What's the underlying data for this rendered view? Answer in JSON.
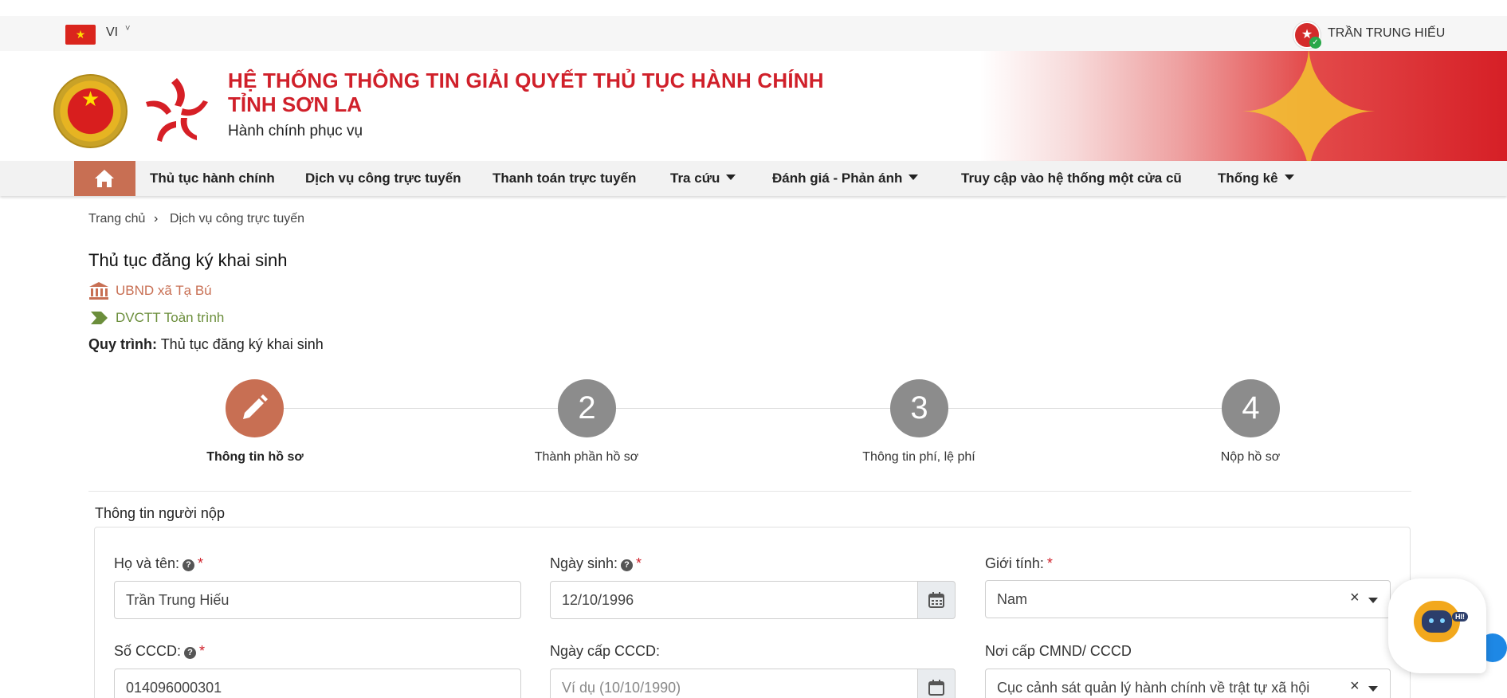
{
  "topbar": {
    "language": "VI",
    "user_name": "TRẦN TRUNG HIẾU"
  },
  "header": {
    "title_line1": "HỆ THỐNG THÔNG TIN GIẢI QUYẾT THỦ TỤC HÀNH CHÍNH",
    "title_line2": "TỈNH SƠN LA",
    "subtitle": "Hành chính phục vụ"
  },
  "nav": {
    "items": [
      {
        "label": "Thủ tục hành chính"
      },
      {
        "label": "Dịch vụ công trực tuyến"
      },
      {
        "label": "Thanh toán trực tuyến"
      },
      {
        "label": "Tra cứu"
      },
      {
        "label": "Đánh giá - Phản ánh"
      },
      {
        "label": "Truy cập vào hệ thống một cửa cũ"
      },
      {
        "label": "Thống kê"
      }
    ]
  },
  "breadcrumb": {
    "home": "Trang chủ",
    "current": "Dịch vụ công trực tuyến"
  },
  "procedure": {
    "title": "Thủ tục đăng ký khai sinh",
    "agency": "UBND xã Tạ Bú",
    "service_level": "DVCTT Toàn trình",
    "process_label": "Quy trình:",
    "process_value": "Thủ tục đăng ký khai sinh"
  },
  "steps": [
    {
      "number": "",
      "label": "Thông tin hồ sơ",
      "active": true
    },
    {
      "number": "2",
      "label": "Thành phần hồ sơ",
      "active": false
    },
    {
      "number": "3",
      "label": "Thông tin phí, lệ phí",
      "active": false
    },
    {
      "number": "4",
      "label": "Nộp hồ sơ",
      "active": false
    }
  ],
  "form": {
    "legend": "Thông tin người nộp",
    "full_name": {
      "label": "Họ và tên:",
      "value": "Trần Trung Hiếu",
      "required_mark": "*"
    },
    "birth_date": {
      "label": "Ngày sinh:",
      "value": "12/10/1996",
      "required_mark": "*"
    },
    "gender": {
      "label": "Giới tính:",
      "value": "Nam",
      "required_mark": "*",
      "clear": "×"
    },
    "id_number": {
      "label": "Số CCCD:",
      "value": "014096000301",
      "required_mark": "*"
    },
    "id_issue_date": {
      "label": "Ngày cấp CCCD:",
      "placeholder": "Ví dụ (10/10/1990)"
    },
    "id_issue_place": {
      "label": "Nơi cấp CMND/ CCCD",
      "value": "Cục cảnh sát quản lý hành chính về trật tự xã hội",
      "clear": "×"
    }
  },
  "chatbot": {
    "badge": "HI!"
  },
  "colors": {
    "brand_red": "#d0202a",
    "accent": "#c86f53",
    "service_green": "#6b8e3b",
    "step_gray": "#8c8c8c"
  }
}
